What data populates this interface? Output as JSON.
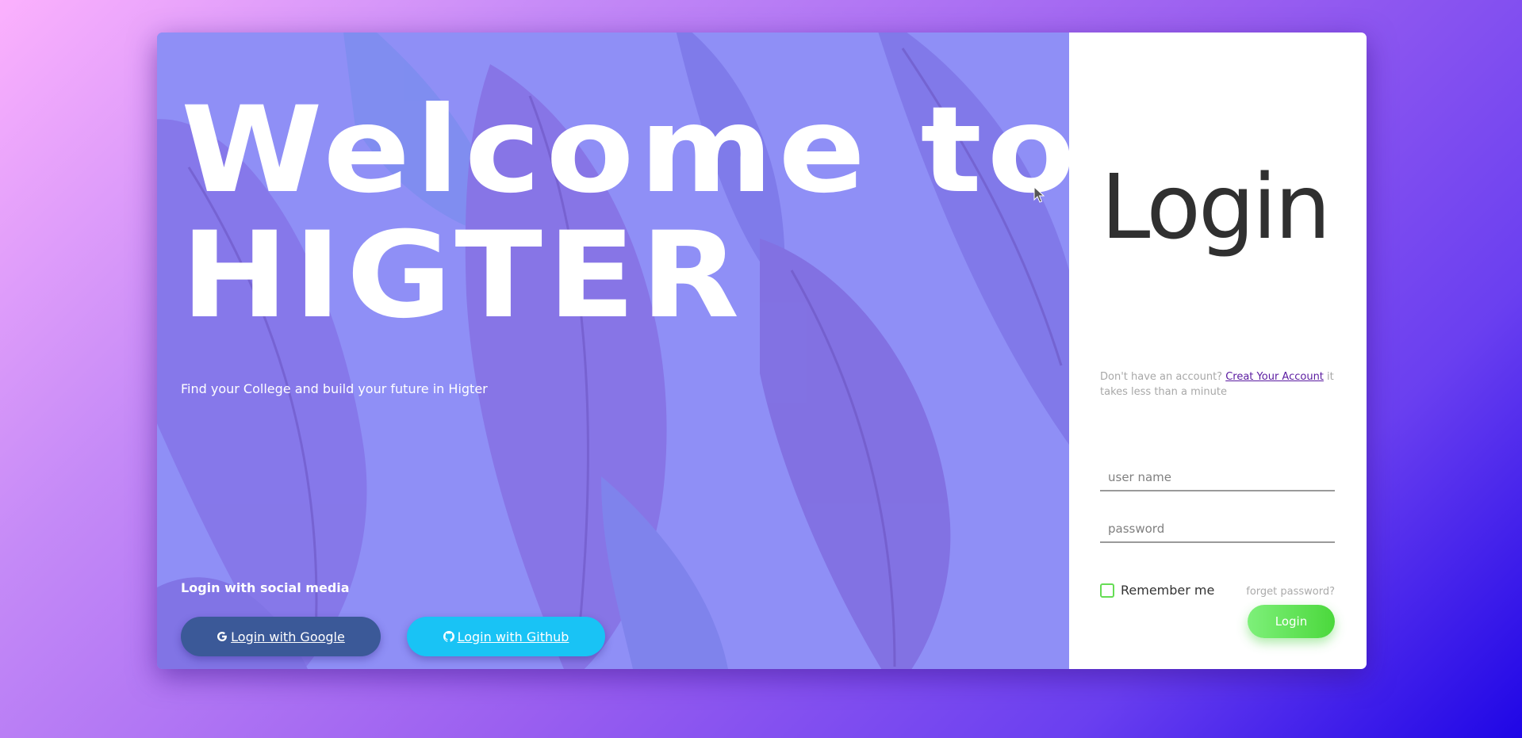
{
  "hero": {
    "title_line1": "Welcome to",
    "title_line2": "HIGTER",
    "tagline": "Find your College and build your future in Higter",
    "social_title": "Login with social media",
    "google_label": " Login with Google",
    "github_label": " Login with Github",
    "google_icon": "google-icon",
    "github_icon": "github-icon"
  },
  "login": {
    "title": "Login",
    "signup_prefix": "Don't have an account? ",
    "signup_link": "Creat Your Account",
    "signup_suffix": " it takes less than a minute",
    "username_placeholder": "user name",
    "password_placeholder": "password",
    "remember_label": "Remember me",
    "forgot_label": "forget password?",
    "submit_label": "Login"
  },
  "colors": {
    "google": "#3b5998",
    "github": "#19c3f5",
    "login_button": "#5ddc4f",
    "hero_overlay": "#8f8ff6"
  }
}
